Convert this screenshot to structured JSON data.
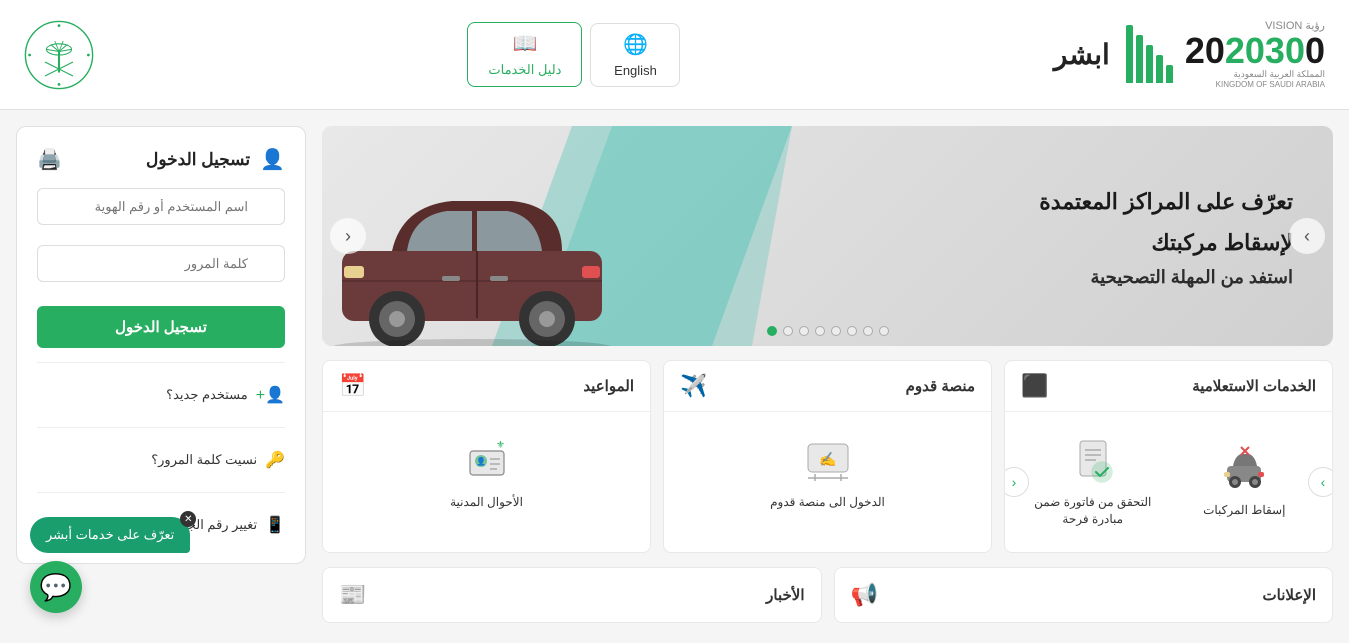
{
  "header": {
    "nav_english": "English",
    "nav_services": "دليل الخدمات",
    "vision_label": "رؤية VISION",
    "vision_year": "2030",
    "kingdom_label": "المملكة العربية السعودية",
    "kingdom_label_en": "KINGDOM OF SAUDI ARABIA",
    "abshir_word": "ابشر"
  },
  "slider": {
    "text_line1": "تعرّف على المراكز المعتمدة",
    "text_line2": "لإسقاط مركبتك",
    "text_line3": "استفد من المهلة التصحيحية",
    "dots_count": 8,
    "active_dot": 7
  },
  "services": {
    "card1": {
      "title": "الخدمات الاستعلامية",
      "icon": "layers",
      "items": [
        {
          "label": "إسقاط المركبات",
          "icon": "🚗"
        },
        {
          "label": "التحقق من فاتورة ضمن مبادرة فرحة",
          "icon": "📋"
        }
      ]
    },
    "card2": {
      "title": "منصة قدوم",
      "icon": "plane",
      "items": [
        {
          "label": "الدخول الى منصة قدوم",
          "icon": "✈️"
        }
      ]
    },
    "card3": {
      "title": "المواعيد",
      "icon": "calendar",
      "items": [
        {
          "label": "الأحوال المدنية",
          "icon": "🆔"
        }
      ]
    }
  },
  "bottom_cards": {
    "card1": {
      "title": "الإعلانات",
      "icon": "📢"
    },
    "card2": {
      "title": "الأخبار",
      "icon": "📰"
    }
  },
  "login": {
    "title": "تسجيل الدخول",
    "title_icon": "👤",
    "username_placeholder": "اسم المستخدم أو رقم الهوية",
    "password_placeholder": "كلمة المرور",
    "login_btn": "تسجيل الدخول",
    "new_user": "مستخدم جديد؟",
    "forgot_password": "نسيت كلمة المرور؟",
    "change_mobile": "تغيير رقم الجوال"
  },
  "chat": {
    "tooltip": "تعرّف على خدمات أبشر",
    "icon": "💬"
  }
}
